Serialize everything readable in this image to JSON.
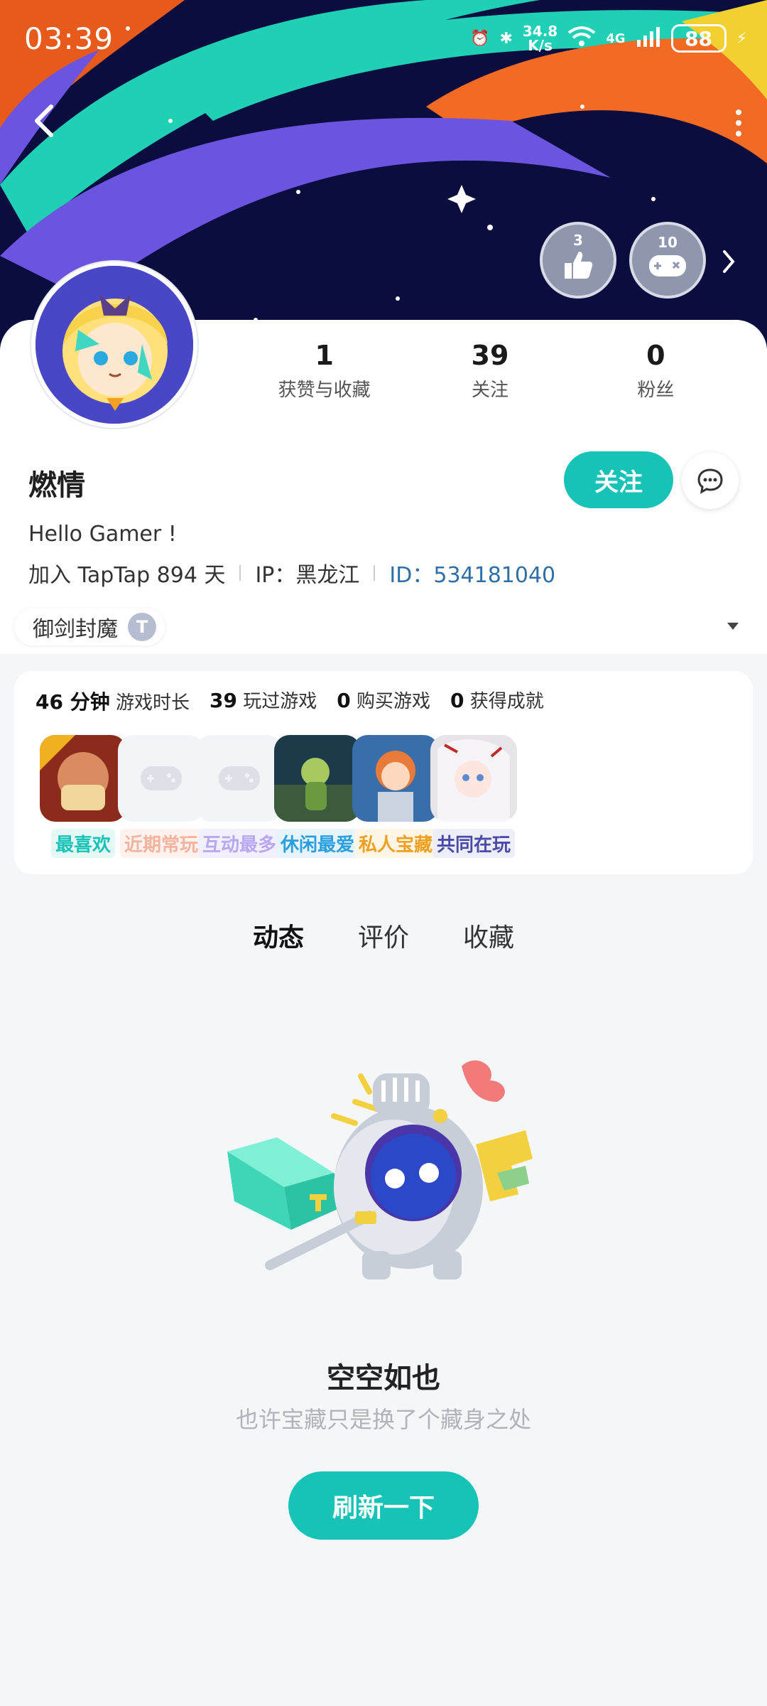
{
  "status_bar": {
    "time": "03:39",
    "net_speed": "34.8",
    "net_unit": "K/s",
    "network": "4G",
    "battery": "88"
  },
  "badges": [
    {
      "num": "3",
      "icon": "thumbs-up-icon"
    },
    {
      "num": "10",
      "icon": "gamepad-icon"
    }
  ],
  "profile": {
    "stats": [
      {
        "value": "1",
        "label": "获赞与收藏"
      },
      {
        "value": "39",
        "label": "关注"
      },
      {
        "value": "0",
        "label": "粉丝"
      }
    ],
    "name": "燃情",
    "follow_label": "关注",
    "bio": "Hello Gamer !",
    "joined": "加入 TapTap 894 天",
    "ip": "IP：黑龙江",
    "id": "ID：534181040",
    "title_chip": "御剑封魔",
    "title_level": "T"
  },
  "games": {
    "summary": [
      {
        "value": "46 分钟",
        "label": "游戏时长"
      },
      {
        "value": "39",
        "label": "玩过游戏"
      },
      {
        "value": "0",
        "label": "购买游戏"
      },
      {
        "value": "0",
        "label": "获得成就"
      }
    ],
    "items": [
      {
        "label": "最喜欢",
        "color": "#17c2b6"
      },
      {
        "label": "近期常玩",
        "color": "#f3b39e"
      },
      {
        "label": "互动最多",
        "color": "#b7a8f0"
      },
      {
        "label": "休闲最爱",
        "color": "#2a9fe0"
      },
      {
        "label": "私人宝藏",
        "color": "#f0a020"
      },
      {
        "label": "共同在玩",
        "color": "#4a4aa8"
      }
    ]
  },
  "tabs": [
    "动态",
    "评价",
    "收藏"
  ],
  "empty": {
    "title": "空空如也",
    "subtitle": "也许宝藏只是换了个藏身之处",
    "refresh_label": "刷新一下"
  },
  "colors": {
    "accent": "#17c2b6",
    "banner_bg": "#0a0d3d"
  }
}
